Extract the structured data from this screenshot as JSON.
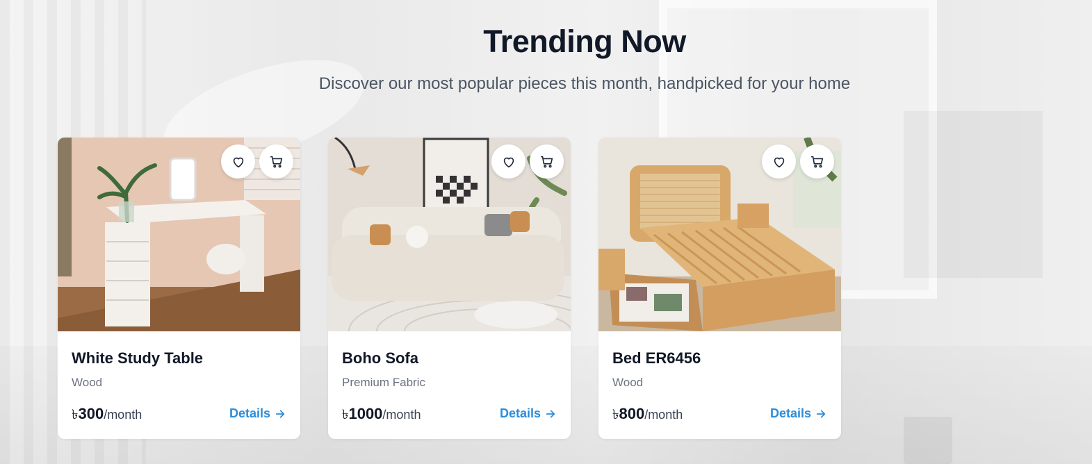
{
  "section": {
    "title": "Trending Now",
    "subtitle": "Discover our most popular pieces this month, handpicked for your home"
  },
  "products": [
    {
      "name": "White Study Table",
      "material": "Wood",
      "currency": "৳",
      "price": "300",
      "period": "/month",
      "details_label": "Details",
      "image": "study-table-photo"
    },
    {
      "name": "Boho Sofa",
      "material": "Premium Fabric",
      "currency": "৳",
      "price": "1000",
      "period": "/month",
      "details_label": "Details",
      "image": "sofa-photo"
    },
    {
      "name": "Bed ER6456",
      "material": "Wood",
      "currency": "৳",
      "price": "800",
      "period": "/month",
      "details_label": "Details",
      "image": "bed-photo"
    }
  ],
  "icons": {
    "favorite": "heart-icon",
    "cart": "cart-icon",
    "details": "arrow-right-icon"
  },
  "colors": {
    "accent": "#2b8ddb",
    "title": "#111827",
    "muted": "#6b7280"
  }
}
